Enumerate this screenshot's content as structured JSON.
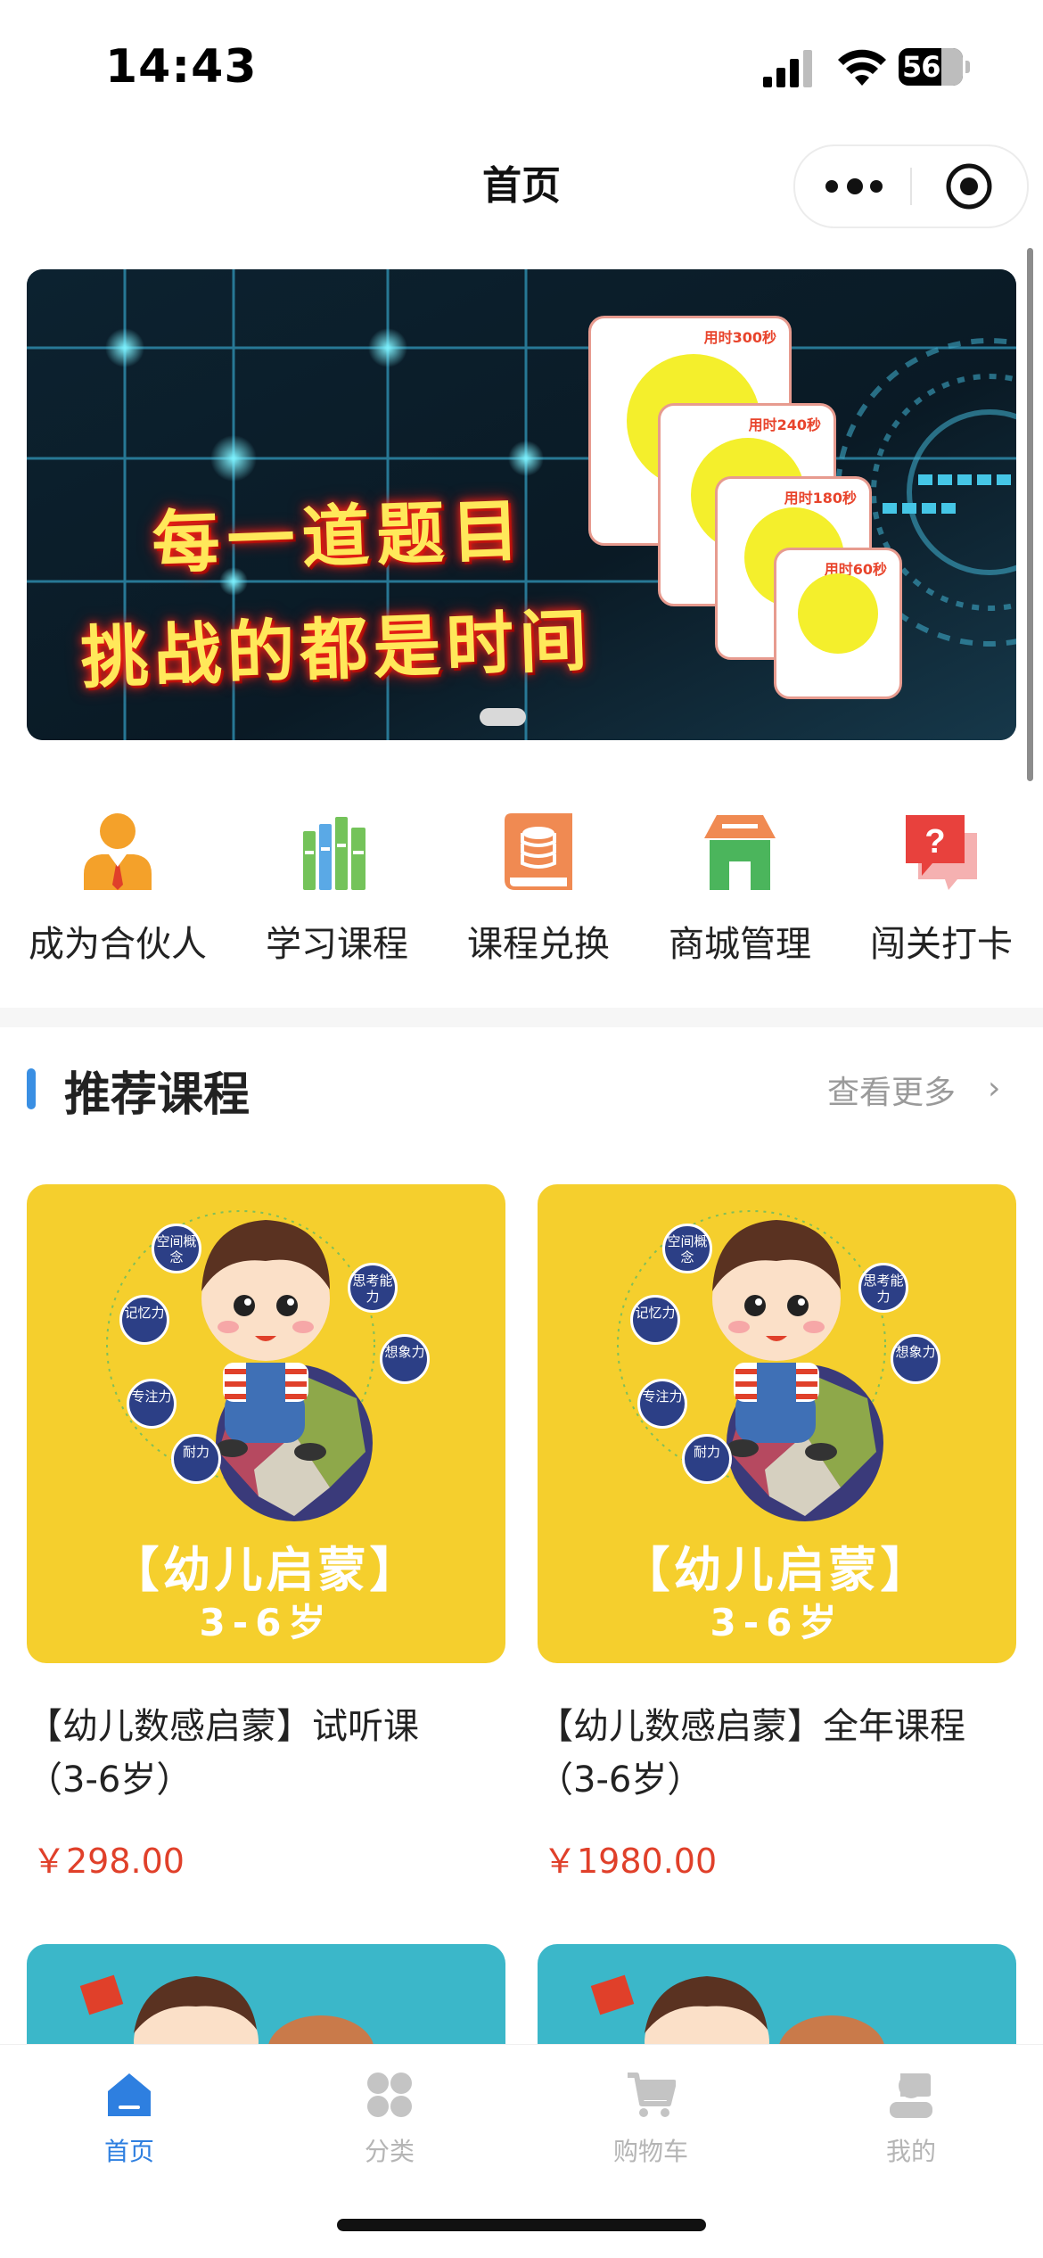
{
  "status_bar": {
    "time": "14:43",
    "battery": "56"
  },
  "nav": {
    "title": "首页"
  },
  "banner": {
    "line1": "每一道题目",
    "line2": "挑战的都是时间",
    "cards": [
      "用时300秒",
      "用时240秒",
      "用时180秒",
      "用时60秒"
    ]
  },
  "quick_menu": [
    {
      "label": "成为合伙人",
      "icon": "partner-icon"
    },
    {
      "label": "学习课程",
      "icon": "books-icon"
    },
    {
      "label": "课程兑换",
      "icon": "coin-book-icon"
    },
    {
      "label": "商城管理",
      "icon": "store-icon"
    },
    {
      "label": "闯关打卡",
      "icon": "question-chat-icon"
    }
  ],
  "section": {
    "title": "推荐课程",
    "more": "查看更多"
  },
  "courses": [
    {
      "name_line1": "【幼儿数感启蒙】试听课",
      "name_line2": "（3-6岁）",
      "price": "￥298.00",
      "img_title": "【幼儿启蒙】",
      "img_age": "3-6岁",
      "bubbles": [
        "空间概念",
        "思考能力",
        "记忆力",
        "想象力",
        "专注力",
        "耐力"
      ]
    },
    {
      "name_line1": "【幼儿数感启蒙】全年课程",
      "name_line2": "（3-6岁）",
      "price": "￥1980.00",
      "img_title": "【幼儿启蒙】",
      "img_age": "3-6岁",
      "bubbles": [
        "空间概念",
        "思考能力",
        "记忆力",
        "想象力",
        "专注力",
        "耐力"
      ]
    }
  ],
  "tabbar": [
    {
      "label": "首页",
      "icon": "home-icon",
      "active": true
    },
    {
      "label": "分类",
      "icon": "category-icon",
      "active": false
    },
    {
      "label": "购物车",
      "icon": "cart-icon",
      "active": false
    },
    {
      "label": "我的",
      "icon": "user-icon",
      "active": false
    }
  ],
  "colors": {
    "accent": "#2e7fe0",
    "price": "#e0402a",
    "course_bg": "#f5cf2d",
    "course2_bg": "#3bb7c9"
  }
}
